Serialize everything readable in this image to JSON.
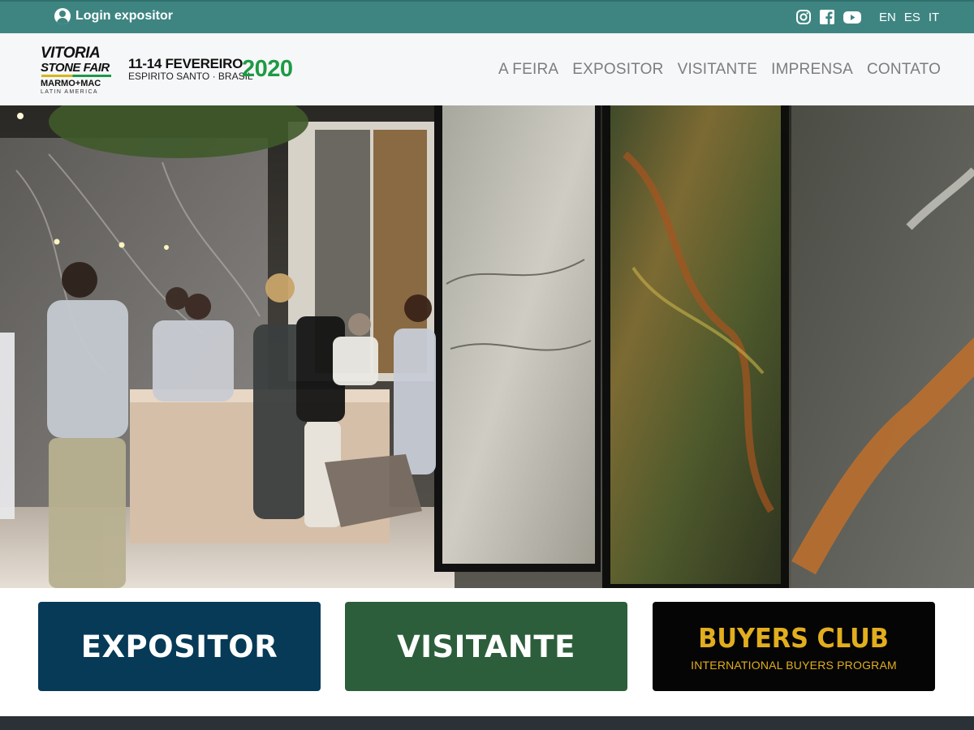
{
  "topbar": {
    "login_label": "Login expositor",
    "socials": [
      "instagram-icon",
      "facebook-icon",
      "youtube-icon"
    ],
    "languages": [
      "EN",
      "ES",
      "IT"
    ],
    "color": "#3e8582"
  },
  "header": {
    "logo": {
      "line1": "VITORIA",
      "line2": "STONE FAIR",
      "line3": "MARMO+MAC",
      "line4": "LATIN AMERICA",
      "dates": "11-14 FEVEREIRO",
      "place": "ESPIRITO SANTO · BRASIL",
      "year": "2020"
    },
    "nav": [
      "A FEIRA",
      "EXPOSITOR",
      "VISITANTE",
      "IMPRENSA",
      "CONTATO"
    ]
  },
  "hero": {
    "alt": "Stone fair exhibition hall with marble slabs and visitors"
  },
  "cards": {
    "expositor": {
      "label": "EXPOSITOR",
      "color": "#063a57"
    },
    "visitante": {
      "label": "VISITANTE",
      "color": "#2c5e3b"
    },
    "buyers": {
      "label": "BUYERS CLUB",
      "sublabel": "INTERNATIONAL BUYERS PROGRAM",
      "color": "#050505",
      "accent": "#e2ae1e"
    }
  }
}
